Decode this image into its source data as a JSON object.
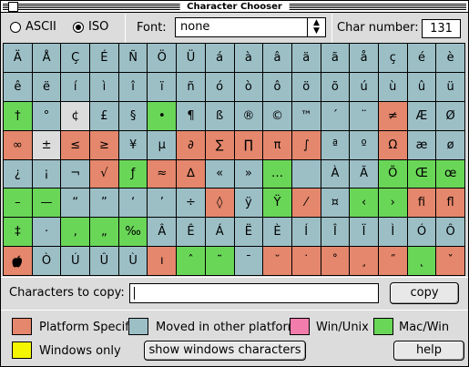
{
  "window": {
    "title": "Character Chooser"
  },
  "mode": {
    "ascii_label": "ASCII",
    "iso_label": "ISO",
    "selected": "ISO"
  },
  "font": {
    "label": "Font:",
    "value": "none"
  },
  "char_number": {
    "label": "Char number:",
    "value": "131"
  },
  "colors": {
    "P": "#e5876c",
    "M": "#9cbfc6",
    "W": "#f27cab",
    "C": "#6ad658",
    "Y": "#f4f500",
    "N": "#dcdcdc"
  },
  "grid": [
    [
      "Ä",
      "Å",
      "Ç",
      "É",
      "Ñ",
      "Ö",
      "Ü",
      "á",
      "à",
      "â",
      "ä",
      "ã",
      "å",
      "ç",
      "é",
      "è"
    ],
    [
      "ê",
      "ë",
      "í",
      "ì",
      "î",
      "ï",
      "ñ",
      "ó",
      "ò",
      "ô",
      "ö",
      "õ",
      "ú",
      "ù",
      "û",
      "ü"
    ],
    [
      "†",
      "°",
      "¢",
      "£",
      "§",
      "•",
      "¶",
      "ß",
      "®",
      "©",
      "™",
      "´",
      "¨",
      "≠",
      "Æ",
      "Ø"
    ],
    [
      "∞",
      "±",
      "≤",
      "≥",
      "¥",
      "µ",
      "∂",
      "∑",
      "∏",
      "π",
      "∫",
      "ª",
      "º",
      "Ω",
      "æ",
      "ø"
    ],
    [
      "¿",
      "¡",
      "¬",
      "√",
      "ƒ",
      "≈",
      "∆",
      "«",
      "»",
      "…",
      " ",
      "À",
      "Ã",
      "Õ",
      "Œ",
      "œ"
    ],
    [
      "–",
      "—",
      "“",
      "”",
      "‘",
      "’",
      "÷",
      "◊",
      "ÿ",
      "Ÿ",
      "⁄",
      "¤",
      "‹",
      "›",
      "ﬁ",
      "ﬂ"
    ],
    [
      "‡",
      "·",
      "‚",
      "„",
      "‰",
      "Â",
      "Ê",
      "Á",
      "Ë",
      "È",
      "Í",
      "Î",
      "Ï",
      "Ì",
      "Ó",
      "Ô"
    ],
    [
      "",
      "Ò",
      "Ú",
      "Û",
      "Ù",
      "ı",
      "ˆ",
      "˜",
      "¯",
      "˘",
      "˙",
      "˚",
      "¸",
      "˝",
      "˛",
      "ˇ"
    ]
  ],
  "categories": [
    [
      "M",
      "M",
      "M",
      "M",
      "M",
      "M",
      "M",
      "M",
      "M",
      "M",
      "M",
      "M",
      "M",
      "M",
      "M",
      "M"
    ],
    [
      "M",
      "M",
      "M",
      "M",
      "M",
      "M",
      "M",
      "M",
      "M",
      "M",
      "M",
      "M",
      "M",
      "M",
      "M",
      "M"
    ],
    [
      "C",
      "M",
      "N",
      "M",
      "M",
      "C",
      "M",
      "M",
      "M",
      "M",
      "M",
      "M",
      "M",
      "P",
      "M",
      "M"
    ],
    [
      "P",
      "N",
      "P",
      "P",
      "M",
      "M",
      "P",
      "P",
      "P",
      "P",
      "P",
      "M",
      "M",
      "P",
      "M",
      "M"
    ],
    [
      "M",
      "M",
      "M",
      "P",
      "C",
      "P",
      "P",
      "M",
      "M",
      "C",
      "M",
      "M",
      "M",
      "C",
      "C",
      "C"
    ],
    [
      "C",
      "C",
      "M",
      "M",
      "M",
      "M",
      "M",
      "P",
      "M",
      "C",
      "P",
      "M",
      "C",
      "C",
      "P",
      "P"
    ],
    [
      "C",
      "M",
      "C",
      "C",
      "C",
      "M",
      "M",
      "M",
      "M",
      "M",
      "M",
      "M",
      "M",
      "M",
      "M",
      "M"
    ],
    [
      "P",
      "M",
      "M",
      "M",
      "M",
      "P",
      "C",
      "C",
      "M",
      "P",
      "P",
      "P",
      "P",
      "P",
      "C",
      "P"
    ]
  ],
  "copy_section": {
    "label": "Characters to copy:",
    "value": "",
    "copy_button": "copy"
  },
  "legend": {
    "platform_specific": "Platform Specific",
    "moved": "Moved in other platforms",
    "win_unix": "Win/Unix",
    "mac_win": "Mac/Win",
    "windows_only": "Windows only"
  },
  "buttons": {
    "show_windows": "show windows characters",
    "help": "help"
  }
}
